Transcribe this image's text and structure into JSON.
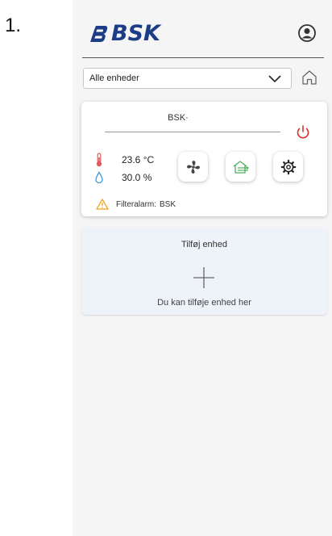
{
  "step_number": "1.",
  "header": {
    "logo_text": "BSK",
    "account_icon": "account-circle-icon"
  },
  "device_selector": {
    "selected": "Alle enheder",
    "chevron_icon": "chevron-down-icon",
    "home_icon": "home-icon"
  },
  "device_card": {
    "name": "BSK·",
    "power_icon": "power-icon",
    "power_color": "#d9302c",
    "temperature": "23.6 °C",
    "humidity": "30.0 %",
    "buttons": [
      {
        "name": "fan",
        "icon": "fan-icon"
      },
      {
        "name": "ventilation",
        "icon": "house-ventilation-icon"
      },
      {
        "name": "settings",
        "icon": "gear-icon"
      }
    ],
    "alarm_label": "Filteralarm:",
    "alarm_device": "BSK",
    "alarm_icon": "warning-icon"
  },
  "add_device": {
    "title": "Tilføj enhed",
    "hint": "Du kan tilføje enhed her",
    "plus_icon": "plus-icon"
  },
  "colors": {
    "brand": "#1c3c86",
    "temperature_icon": "#e05a5a",
    "humidity_icon": "#3f9ad6",
    "warning": "#f0a21c",
    "ventilation_icon": "#4fae5a",
    "add_card_bg": "#edf3f9"
  }
}
